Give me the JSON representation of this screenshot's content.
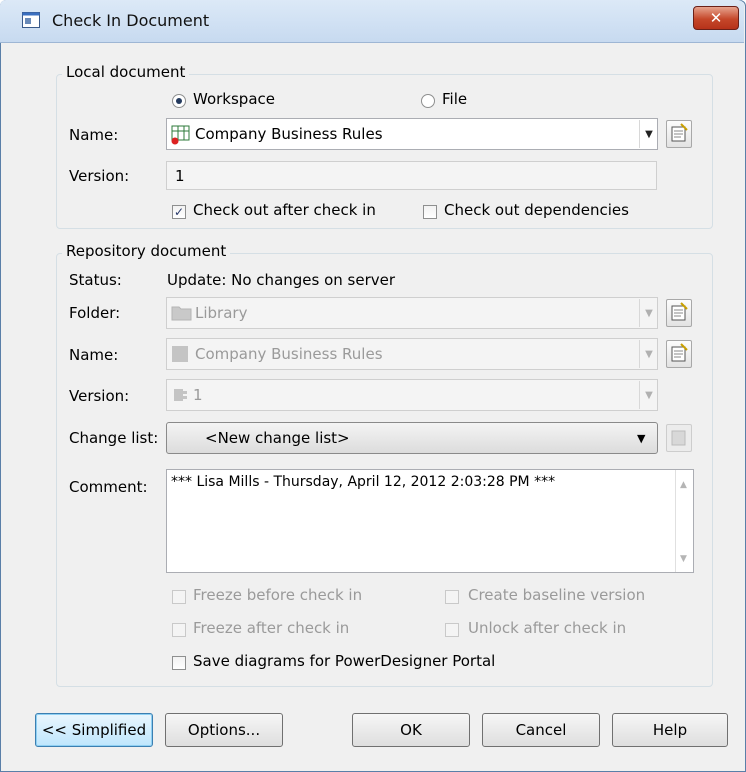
{
  "window": {
    "title": "Check In Document",
    "close_label": "✕"
  },
  "local": {
    "group_label": "Local document",
    "radio_workspace": "Workspace",
    "radio_file": "File",
    "selected": "Workspace",
    "name_label": "Name:",
    "name_value": "Company Business Rules",
    "version_label": "Version:",
    "version_value": "1",
    "checkout_after_label": "Check out after check in",
    "checkout_after_checked": true,
    "checkout_deps_label": "Check out dependencies",
    "checkout_deps_checked": false
  },
  "repo": {
    "group_label": "Repository document",
    "status_label": "Status:",
    "status_value": "Update: No changes on server",
    "folder_label": "Folder:",
    "folder_value": "Library",
    "name_label": "Name:",
    "name_value": "Company Business Rules",
    "version_label": "Version:",
    "version_value": "1",
    "changelist_label": "Change list:",
    "changelist_value": "<New change list>",
    "comment_label": "Comment:",
    "comment_value": "*** Lisa Mills - Thursday, April 12, 2012 2:03:28 PM ***",
    "freeze_before_label": "Freeze before check in",
    "create_baseline_label": "Create baseline version",
    "freeze_after_label": "Freeze after check in",
    "unlock_after_label": "Unlock after check in",
    "save_diagrams_label": "Save diagrams for PowerDesigner Portal",
    "save_diagrams_checked": false
  },
  "buttons": {
    "simplified": "<< Simplified",
    "options": "Options...",
    "ok": "OK",
    "cancel": "Cancel",
    "help": "Help"
  }
}
